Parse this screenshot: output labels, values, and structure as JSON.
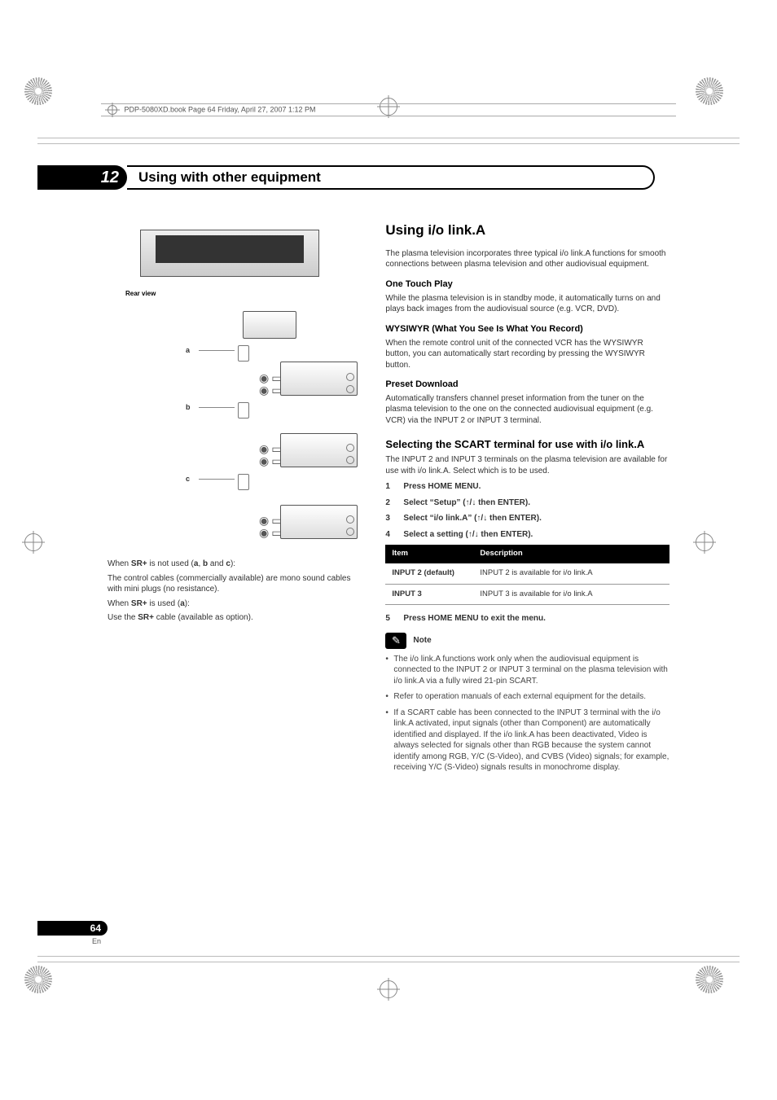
{
  "meta": {
    "header_line": "PDP-5080XD.book  Page 64  Friday, April 27, 2007  1:12 PM"
  },
  "chapter": {
    "number": "12",
    "title": "Using with other equipment"
  },
  "figure": {
    "rear_view_label": "Rear view",
    "label_a": "a",
    "label_b": "b",
    "label_c": "c"
  },
  "left_column": {
    "p1_pre": "When ",
    "p1_bold1": "SR+",
    "p1_mid": " is not used (",
    "p1_a": "a",
    "p1_sep1": ", ",
    "p1_b": "b",
    "p1_sep2": " and ",
    "p1_c": "c",
    "p1_post": "):",
    "p2": "The control cables (commercially available) are mono sound cables with mini plugs (no resistance).",
    "p3_pre": "When ",
    "p3_bold1": "SR+",
    "p3_mid": " is used (",
    "p3_a": "a",
    "p3_post": "):",
    "p4_pre": "Use the ",
    "p4_bold": "SR+",
    "p4_post": " cable (available as option)."
  },
  "right_column": {
    "section_title": "Using i/o link.A",
    "intro": "The plasma television incorporates three typical i/o link.A functions for smooth connections between plasma television and other audiovisual equipment.",
    "otp_title": "One Touch Play",
    "otp_body": "While the plasma television is in standby mode, it automatically turns on and plays back images from the audiovisual source (e.g. VCR, DVD).",
    "wys_title": "WYSIWYR (What You See Is What You Record)",
    "wys_body": "When the remote control unit of the connected VCR has the WYSIWYR button, you can automatically start recording by pressing the WYSIWYR button.",
    "preset_title": "Preset Download",
    "preset_body": "Automatically transfers channel preset information from the tuner on the plasma television to the one on the connected audiovisual equipment (e.g. VCR) via the INPUT 2 or INPUT 3 terminal.",
    "select_title": "Selecting the SCART terminal for use with i/o link.A",
    "select_intro": "The INPUT 2 and INPUT 3 terminals on the plasma television are available for use with i/o link.A. Select which is to be used.",
    "steps": [
      "Press HOME MENU.",
      "Select “Setup” (↑/↓ then ENTER).",
      "Select “i/o link.A” (↑/↓ then ENTER).",
      "Select a setting (↑/↓ then ENTER)."
    ],
    "table": {
      "head_item": "Item",
      "head_desc": "Description",
      "rows": [
        {
          "item": "INPUT 2 (default)",
          "desc": "INPUT 2 is available for i/o link.A"
        },
        {
          "item": "INPUT 3",
          "desc": "INPUT 3 is available for i/o link.A"
        }
      ]
    },
    "step5": "Press HOME MENU to exit the menu.",
    "note_label": "Note",
    "notes": [
      "The i/o link.A functions work only when the audiovisual equipment is connected to the INPUT 2 or INPUT 3 terminal on the plasma television with i/o link.A via a fully wired 21-pin SCART.",
      "Refer to operation manuals of each external equipment for the details.",
      "If a SCART cable has been connected to the INPUT 3 terminal with the i/o link.A activated, input signals (other than Component) are automatically identified and displayed. If the i/o link.A has been deactivated, Video is always selected for signals other than RGB because the system cannot identify among RGB, Y/C (S-Video), and CVBS (Video) signals; for example, receiving Y/C (S-Video) signals results in monochrome display."
    ]
  },
  "page_footer": {
    "page_number": "64",
    "lang": "En"
  }
}
